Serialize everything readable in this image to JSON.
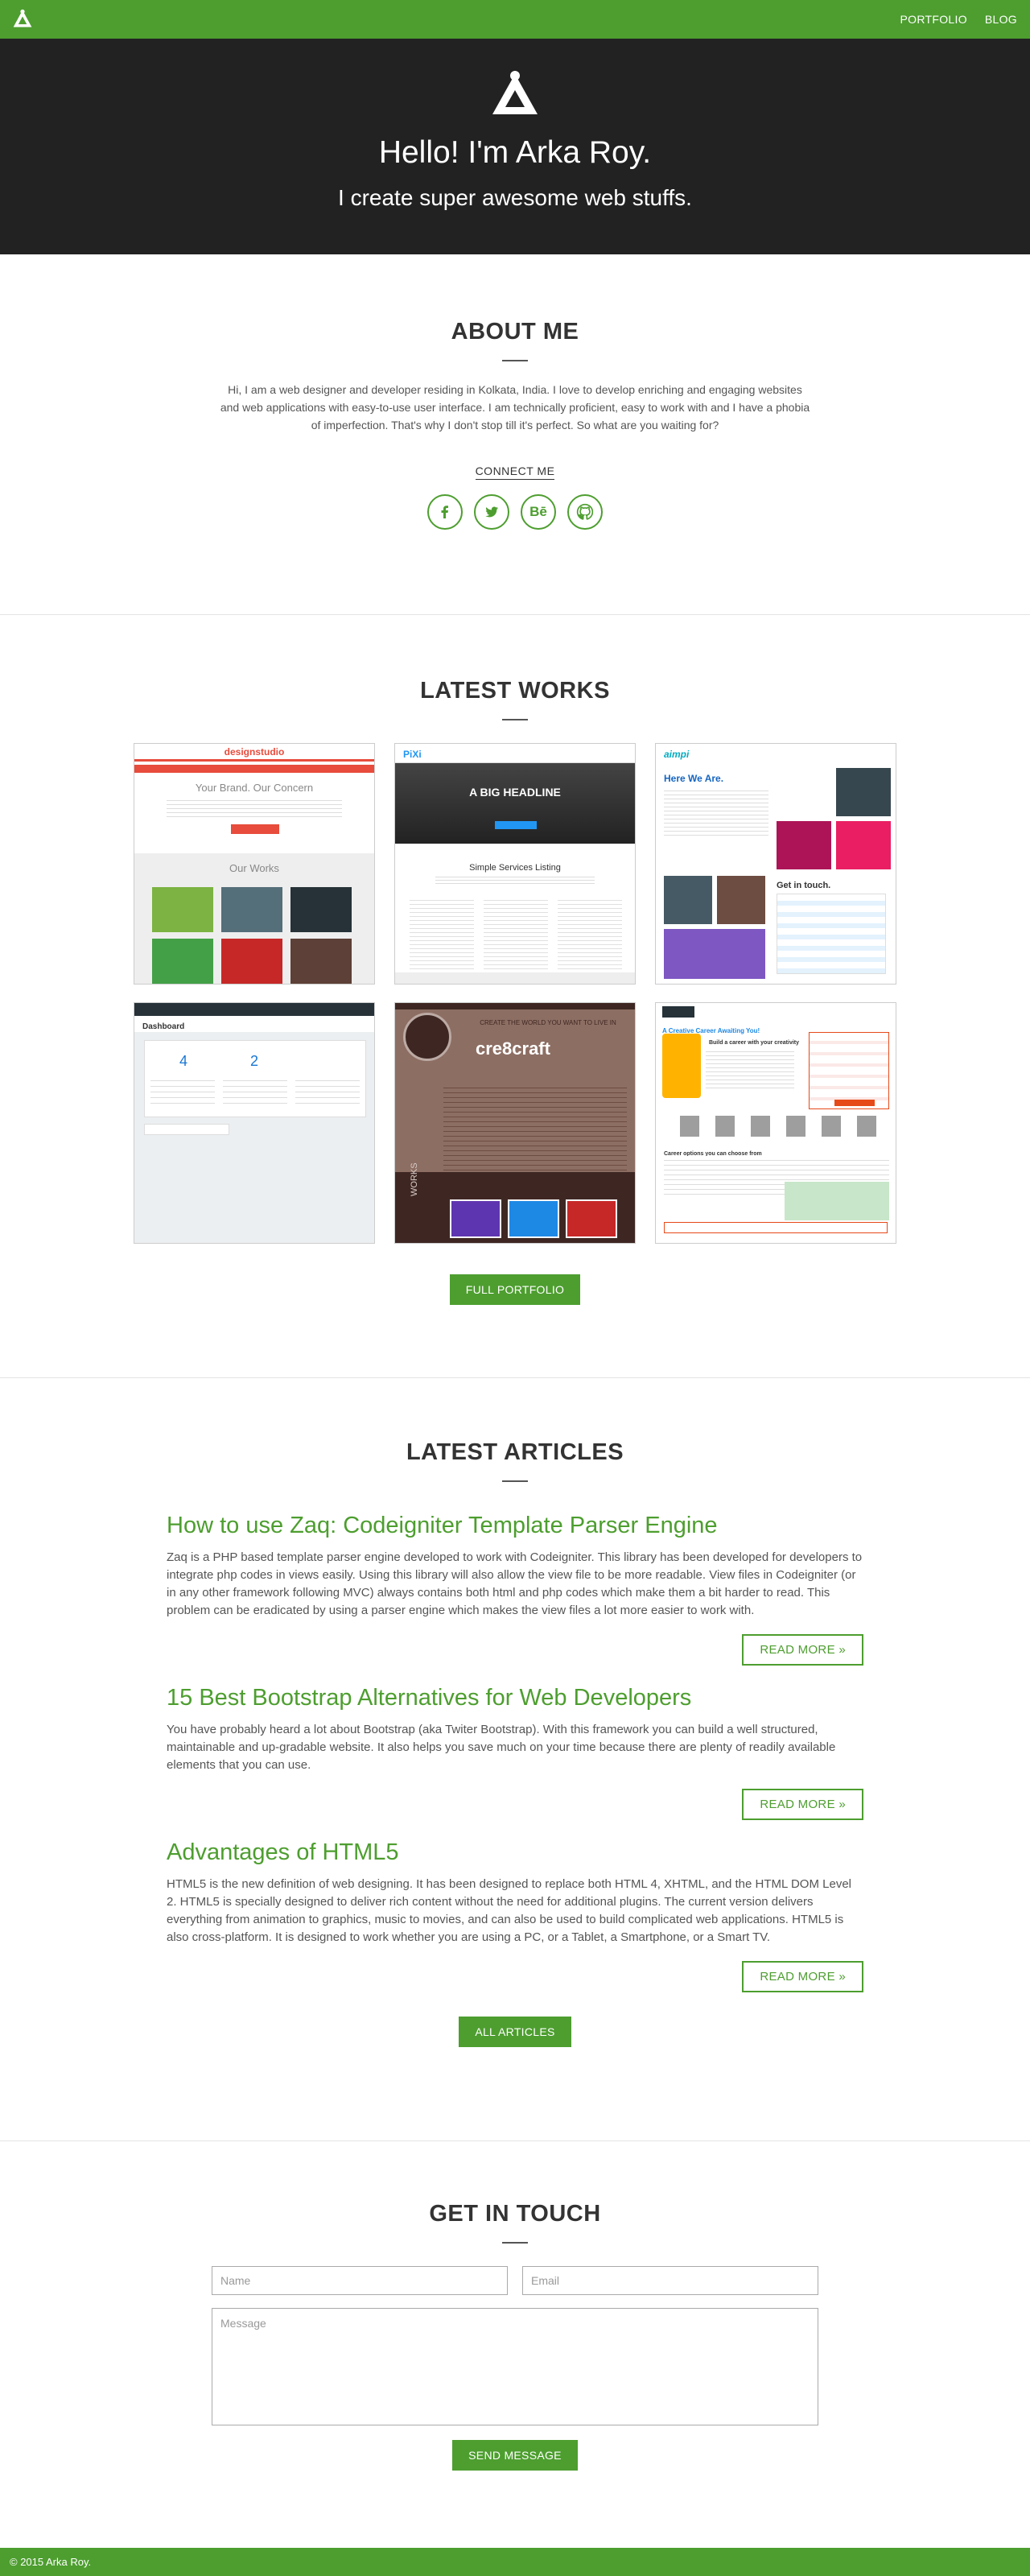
{
  "nav": {
    "links": [
      "PORTFOLIO",
      "BLOG"
    ]
  },
  "hero": {
    "title": "Hello! I'm Arka Roy.",
    "subtitle": "I create super awesome web stuffs."
  },
  "about": {
    "title": "ABOUT ME",
    "text": "Hi, I am a web designer and developer residing in Kolkata, India. I love to develop enriching and engaging websites and web applications with easy-to-use user interface. I am technically proficient, easy to work with and I have a phobia of imperfection. That's why I don't stop till it's perfect. So what are you waiting for?",
    "connect_label": "CONNECT ME",
    "social": [
      {
        "icon": "facebook-icon",
        "glyph": "f"
      },
      {
        "icon": "twitter-icon",
        "glyph": "t"
      },
      {
        "icon": "behance-icon",
        "glyph": "Bē"
      },
      {
        "icon": "github-icon",
        "glyph": "g"
      }
    ]
  },
  "works": {
    "title": "LATEST WORKS",
    "button": "FULL PORTFOLIO",
    "items": [
      {
        "heading": "designstudio",
        "line1": "Your Brand. Our Concern",
        "line2": "Our Works"
      },
      {
        "heading": "PiXi",
        "line1": "A BIG HEADLINE",
        "line2": "Simple Services Listing"
      },
      {
        "heading": "aimpi",
        "line1": "Here We Are.",
        "line2": "Get in touch."
      },
      {
        "heading": "Dashboard",
        "line1": "4",
        "line2": "2"
      },
      {
        "heading": "cre8craft",
        "line1": "CREATE THE WORLD YOU WANT TO LIVE IN",
        "line2": "WORKS"
      },
      {
        "heading": "A Creative Career Awaiting You!",
        "line1": "Build a career with your creativity and passion",
        "line2": "Career options you can choose from"
      }
    ]
  },
  "articles": {
    "title": "LATEST ARTICLES",
    "read_more": "READ MORE",
    "button": "ALL ARTICLES",
    "items": [
      {
        "title": "How to use Zaq: Codeigniter Template Parser Engine",
        "body": "Zaq is a PHP based template parser engine developed to work with Codeigniter. This library has been developed for developers to integrate php codes in views easily. Using this library will also allow the view file to be more readable. View files in Codeigniter (or in any other framework following MVC) always contains both html and php codes which make them a bit harder to read. This problem can be eradicated by using a parser engine which makes the view files a lot more easier to work with."
      },
      {
        "title": "15 Best Bootstrap Alternatives for Web Developers",
        "body": "You have probably heard a lot about Bootstrap (aka Twiter Bootstrap). With this framework you can build a well structured, maintainable and up-gradable website. It also helps you save much on your time because there are plenty of readily available elements that you can use."
      },
      {
        "title": "Advantages of HTML5",
        "body": "HTML5 is the new definition of web designing. It has been designed to replace both HTML 4, XHTML, and the HTML DOM Level 2. HTML5 is specially designed to deliver rich content without the need for additional plugins. The current version delivers everything from animation to graphics, music to movies, and can also be used to build complicated web applications. HTML5 is also cross-platform. It is designed to work whether you are using a PC, or a Tablet, a Smartphone, or a Smart TV."
      }
    ]
  },
  "contact": {
    "title": "GET IN TOUCH",
    "name_placeholder": "Name",
    "email_placeholder": "Email",
    "message_placeholder": "Message",
    "button": "SEND MESSAGE"
  },
  "footer": {
    "text": "© 2015 Arka Roy."
  },
  "colors": {
    "brand_green": "#4d9e2f",
    "hero_dark": "#222222"
  }
}
